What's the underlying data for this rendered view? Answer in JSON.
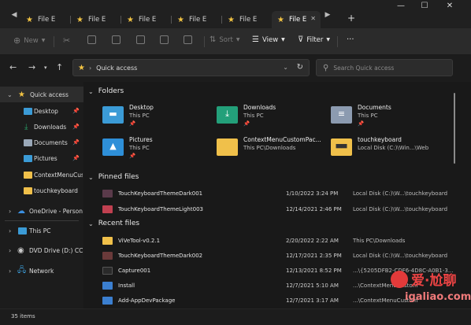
{
  "tabs": [
    {
      "label": "File E"
    },
    {
      "label": "File E"
    },
    {
      "label": "File E"
    },
    {
      "label": "File E"
    },
    {
      "label": "File E"
    },
    {
      "label": "File E",
      "active": true
    }
  ],
  "window_controls": {
    "minimize": "—",
    "maximize": "☐",
    "close": "✕"
  },
  "toolbar": {
    "new_label": "New",
    "sort_label": "Sort",
    "view_label": "View",
    "filter_label": "Filter",
    "more_label": "···"
  },
  "address": {
    "path": "Quick access",
    "search_placeholder": "Search Quick access"
  },
  "sidebar": {
    "quick_access": "Quick access",
    "items": [
      {
        "label": "Desktop",
        "pinned": true,
        "icon": "desktop-icon",
        "color": "#3b9bd6"
      },
      {
        "label": "Downloads",
        "pinned": true,
        "icon": "downloads-icon",
        "color": "#2aa36a"
      },
      {
        "label": "Documents",
        "pinned": true,
        "icon": "documents-icon",
        "color": "#9aa8b8"
      },
      {
        "label": "Pictures",
        "pinned": true,
        "icon": "pictures-icon",
        "color": "#3b9bd6"
      },
      {
        "label": "ContextMenuCust",
        "pinned": false,
        "icon": "folder-icon",
        "color": "#f0c04a"
      },
      {
        "label": "touchkeyboard",
        "pinned": false,
        "icon": "folder-icon",
        "color": "#f0c04a"
      }
    ],
    "onedrive": "OneDrive - Personal",
    "thispc": "This PC",
    "dvd": "DVD Drive (D:) CCCO",
    "network": "Network"
  },
  "main": {
    "folders_header": "Folders",
    "folders": [
      {
        "name": "Desktop",
        "sub": "This PC",
        "pinned": true,
        "icon": "desktop-icon",
        "color": "#3b9bd6"
      },
      {
        "name": "Downloads",
        "sub": "This PC",
        "pinned": true,
        "icon": "downloads-icon",
        "color": "#23a07a"
      },
      {
        "name": "Documents",
        "sub": "This PC",
        "pinned": true,
        "icon": "documents-icon",
        "color": "#8c9bb0"
      },
      {
        "name": "Pictures",
        "sub": "This PC",
        "pinned": true,
        "icon": "pictures-icon",
        "color": "#2e8fd8"
      },
      {
        "name": "ContextMenuCustomPac...",
        "sub": "This PC\\Downloads",
        "pinned": false,
        "icon": "folder-icon",
        "color": "#f0c04a"
      },
      {
        "name": "touchkeyboard",
        "sub": "Local Disk (C:)\\Win...\\Web",
        "pinned": false,
        "icon": "folder-icon",
        "color": "#f0c04a"
      }
    ],
    "pinned_header": "Pinned files",
    "pinned_files": [
      {
        "name": "TouchKeyboardThemeDark001",
        "date": "1/10/2022 3:24 PM",
        "location": "Local Disk (C:)\\W...\\touchkeyboard",
        "color": "#5a3a4a"
      },
      {
        "name": "TouchKeyboardThemeLight003",
        "date": "12/14/2021 2:46 PM",
        "location": "Local Disk (C:)\\W...\\touchkeyboard",
        "color": "#c04050"
      }
    ],
    "recent_header": "Recent files",
    "recent_files": [
      {
        "name": "ViVeTool-v0.2.1",
        "date": "2/20/2022 2:22 AM",
        "location": "This PC\\Downloads",
        "color": "#f0c04a"
      },
      {
        "name": "TouchKeyboardThemeDark002",
        "date": "12/17/2021 2:35 PM",
        "location": "Local Disk (C:)\\W...\\touchkeyboard",
        "color": "#6a3a3a"
      },
      {
        "name": "Capture001",
        "date": "12/13/2021 8:52 PM",
        "location": "...\\{5205DFB2-CDF6-4D8C-A0B1-3...",
        "color": "#2a2a2a"
      },
      {
        "name": "Install",
        "date": "12/7/2021 5:10 AM",
        "location": "...\\ContextMenuCustom",
        "color": "#3b7fd0"
      },
      {
        "name": "Add-AppDevPackage",
        "date": "12/7/2021 3:17 AM",
        "location": "...\\ContextMenuCustom",
        "color": "#3b7fd0"
      }
    ]
  },
  "status": {
    "items_count": "35 items"
  },
  "watermark": {
    "cn": "爱·尬聊",
    "en": "igaliao.com"
  }
}
